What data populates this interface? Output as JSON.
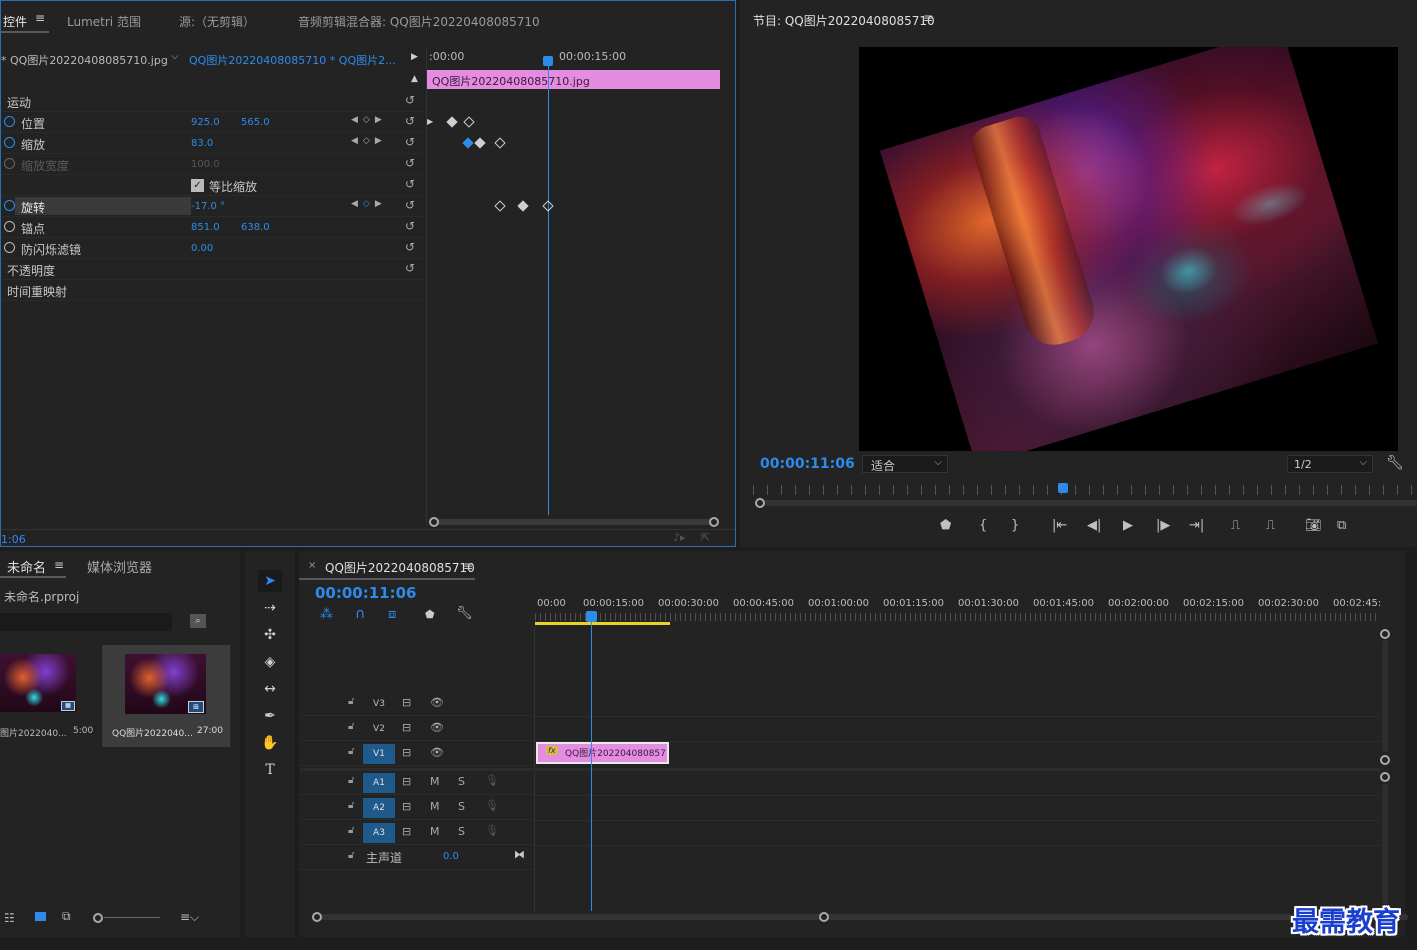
{
  "effect_controls": {
    "tabs": [
      "控件",
      "Lumetri 范围",
      "源:（无剪辑）",
      "音频剪辑混合器: QQ图片20220408085710"
    ],
    "source_label": "* QQ图片20220408085710.jpg",
    "sequence_label": "QQ图片20220408085710 * QQ图片2...",
    "time_start": ":00:00",
    "time_mid": "00:00:15:00",
    "clip_label": "QQ图片20220408085710.jpg",
    "timecode": "1:06",
    "rows": [
      {
        "label": "运动",
        "v1": "",
        "v2": ""
      },
      {
        "label": "位置",
        "v1": "925.0",
        "v2": "565.0"
      },
      {
        "label": "缩放",
        "v1": "83.0",
        "v2": ""
      },
      {
        "label": "缩放宽度",
        "v1": "100.0",
        "v2": ""
      },
      {
        "label": "等比缩放",
        "v1": "",
        "v2": ""
      },
      {
        "label": "旋转",
        "v1": "-17.0 °",
        "v2": ""
      },
      {
        "label": "锚点",
        "v1": "851.0",
        "v2": "638.0"
      },
      {
        "label": "防闪烁滤镜",
        "v1": "0.00",
        "v2": ""
      },
      {
        "label": "不透明度",
        "v1": "",
        "v2": ""
      },
      {
        "label": "时间重映射",
        "v1": "",
        "v2": ""
      }
    ]
  },
  "program_monitor": {
    "title": "节目: QQ图片20220408085710",
    "timecode": "00:00:11:06",
    "fit": "适合",
    "resolution": "1/2"
  },
  "project": {
    "tabs": [
      "未命名",
      "媒体浏览器"
    ],
    "project_file": "未命名.prproj",
    "items": [
      {
        "name": "图片2022040...",
        "duration": "5:00"
      },
      {
        "name": "QQ图片2022040...",
        "duration": "27:00"
      }
    ]
  },
  "timeline": {
    "title": "QQ图片20220408085710",
    "timecode": "00:00:11:06",
    "ruler": [
      "00:00",
      "00:00:15:00",
      "00:00:30:00",
      "00:00:45:00",
      "00:01:00:00",
      "00:01:15:00",
      "00:01:30:00",
      "00:01:45:00",
      "00:02:00:00",
      "00:02:15:00",
      "00:02:30:00",
      "00:02:45:"
    ],
    "tracks": [
      "V3",
      "V2",
      "V1",
      "A1",
      "A2",
      "A3"
    ],
    "master_label": "主声道",
    "master_value": "0.0",
    "clip_label": "QQ图片202204080857",
    "fx": "fx",
    "m": "M",
    "s": "S"
  },
  "watermark": "最需教育"
}
